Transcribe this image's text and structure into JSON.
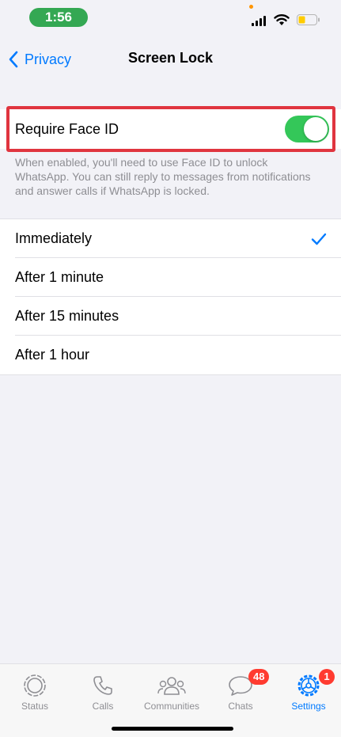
{
  "status_bar": {
    "time": "1:56"
  },
  "nav": {
    "back_label": "Privacy",
    "title": "Screen Lock"
  },
  "face_id": {
    "label": "Require Face ID",
    "enabled": true,
    "footnote": "When enabled, you'll need to use Face ID to unlock WhatsApp. You can still reply to messages from notifications and answer calls if WhatsApp is locked."
  },
  "options": [
    {
      "label": "Immediately",
      "selected": true
    },
    {
      "label": "After 1 minute",
      "selected": false
    },
    {
      "label": "After 15 minutes",
      "selected": false
    },
    {
      "label": "After 1 hour",
      "selected": false
    }
  ],
  "tabs": [
    {
      "label": "Status",
      "icon": "status-icon"
    },
    {
      "label": "Calls",
      "icon": "phone-icon"
    },
    {
      "label": "Communities",
      "icon": "communities-icon"
    },
    {
      "label": "Chats",
      "icon": "chats-icon",
      "badge": "48"
    },
    {
      "label": "Settings",
      "icon": "gear-icon",
      "badge": "1",
      "active": true
    }
  ],
  "colors": {
    "accent": "#007aff",
    "toggle_on": "#34c759",
    "badge": "#ff3b30",
    "highlight": "#e0353f"
  }
}
